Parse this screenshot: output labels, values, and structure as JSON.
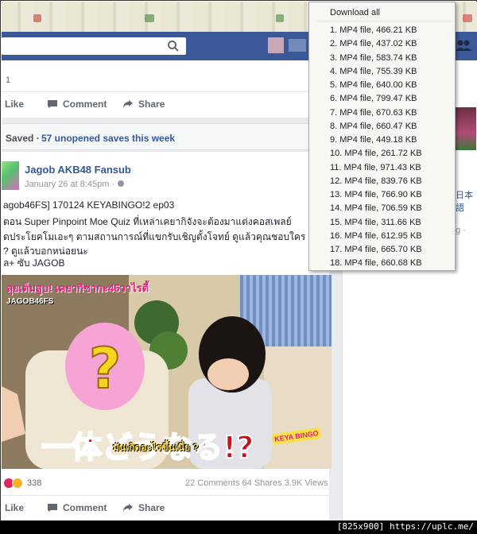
{
  "browser": {
    "status_text": "[825x900] https://uplc.me/"
  },
  "header": {
    "search_placeholder": ""
  },
  "top_post": {
    "count_fragment": "1",
    "actions": {
      "like": "Like",
      "comment": "Comment",
      "share": "Share"
    }
  },
  "saved_bar": {
    "label": "Saved ·",
    "count_text": "57 unopened saves this week"
  },
  "post": {
    "page_name": "Jagob AKB48 Fansub",
    "date": "January 26 at 8:45pm ·",
    "lines": [
      "agob46FS] 170124 KEYABINGO!2 ep03",
      "ตอน Super Pinpoint Moe Quiz ที่เหล่าเคยากิจังจะต้องมาแต่งคอสเพลย์",
      "ดประโยคโมเอะๆ ตามสถานการณ์ที่แขกรับเชิญตั้งโจทย์ ดูแล้วคุณชอบใคร",
      "? ดูแล้วบอกหน่อยนะ",
      "ล+ ซับ JAGOB"
    ],
    "video": {
      "caption_top": "ลุยเต็มสูบ! เคยากิซากะ46วาไรตี้",
      "watermark": "JAGOB46FS",
      "subtitle_jp": "一体どうなる!?",
      "subtitle_th": "มันเกิดอะไรขึ้นเนี่ย ?",
      "logo_text": "KEYA BINGO"
    },
    "reaction_count": "338",
    "stats": "22 Comments  64 Shares  3.9K Views",
    "actions": {
      "like": "Like",
      "comment": "Comment",
      "share": "Share"
    }
  },
  "right_col": {
    "jp_fragment": "日本語",
    "ng_fragment": "ng ·"
  },
  "download_menu": {
    "download_all": "Download all",
    "items": [
      "1.  MP4 file,  466.21  KB",
      "2.  MP4 file,  437.02  KB",
      "3.  MP4 file,  583.74  KB",
      "4.  MP4 file,  755.39  KB",
      "5.  MP4 file,  640.00  KB",
      "6.  MP4 file,  799.47  KB",
      "7.  MP4 file,  670.63  KB",
      "8.  MP4 file,  660.47  KB",
      "9.  MP4 file,  449.18  KB",
      "10.  MP4 file,  261.72  KB",
      "11.  MP4 file,  971.43  KB",
      "12.  MP4 file,  839.76  KB",
      "13.  MP4 file,  766.90  KB",
      "14.  MP4 file,  706.59  KB",
      "15.  MP4 file,  311.66  KB",
      "16.  MP4 file,  612.95  KB",
      "17.  MP4 file,  665.70  KB",
      "18.  MP4 file,  660.68  KB"
    ]
  },
  "colors": {
    "fb_blue": "#3b5998",
    "link_blue": "#365899",
    "feed_bg": "#e9ebee"
  }
}
